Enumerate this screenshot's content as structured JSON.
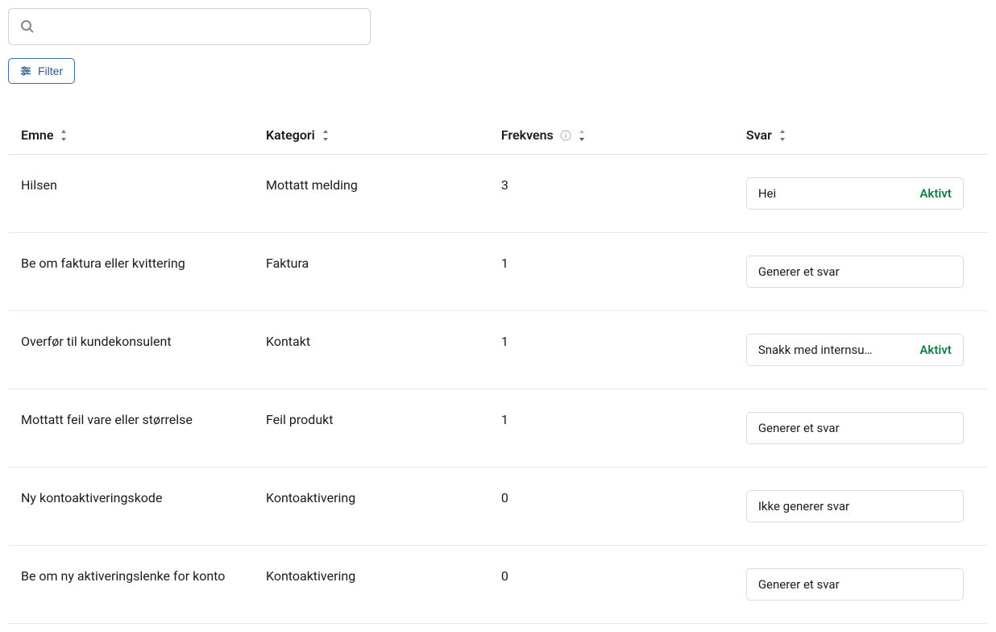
{
  "search": {
    "placeholder": ""
  },
  "filter": {
    "label": "Filter"
  },
  "columns": {
    "emne": "Emne",
    "kategori": "Kategori",
    "frekvens": "Frekvens",
    "svar": "Svar"
  },
  "rows": [
    {
      "emne": "Hilsen",
      "kategori": "Mottatt melding",
      "frekvens": "3",
      "svar_text": "Hei",
      "svar_status": "Aktivt"
    },
    {
      "emne": "Be om faktura eller kvittering",
      "kategori": "Faktura",
      "frekvens": "1",
      "svar_text": "Generer et svar",
      "svar_status": ""
    },
    {
      "emne": "Overfør til kundekonsulent",
      "kategori": "Kontakt",
      "frekvens": "1",
      "svar_text": "Snakk med internsu…",
      "svar_status": "Aktivt"
    },
    {
      "emne": "Mottatt feil vare eller størrelse",
      "kategori": "Feil produkt",
      "frekvens": "1",
      "svar_text": "Generer et svar",
      "svar_status": ""
    },
    {
      "emne": "Ny kontoaktiveringskode",
      "kategori": "Kontoaktivering",
      "frekvens": "0",
      "svar_text": "Ikke generer svar",
      "svar_status": ""
    },
    {
      "emne": "Be om ny aktiveringslenke for konto",
      "kategori": "Kontoaktivering",
      "frekvens": "0",
      "svar_text": "Generer et svar",
      "svar_status": ""
    }
  ]
}
